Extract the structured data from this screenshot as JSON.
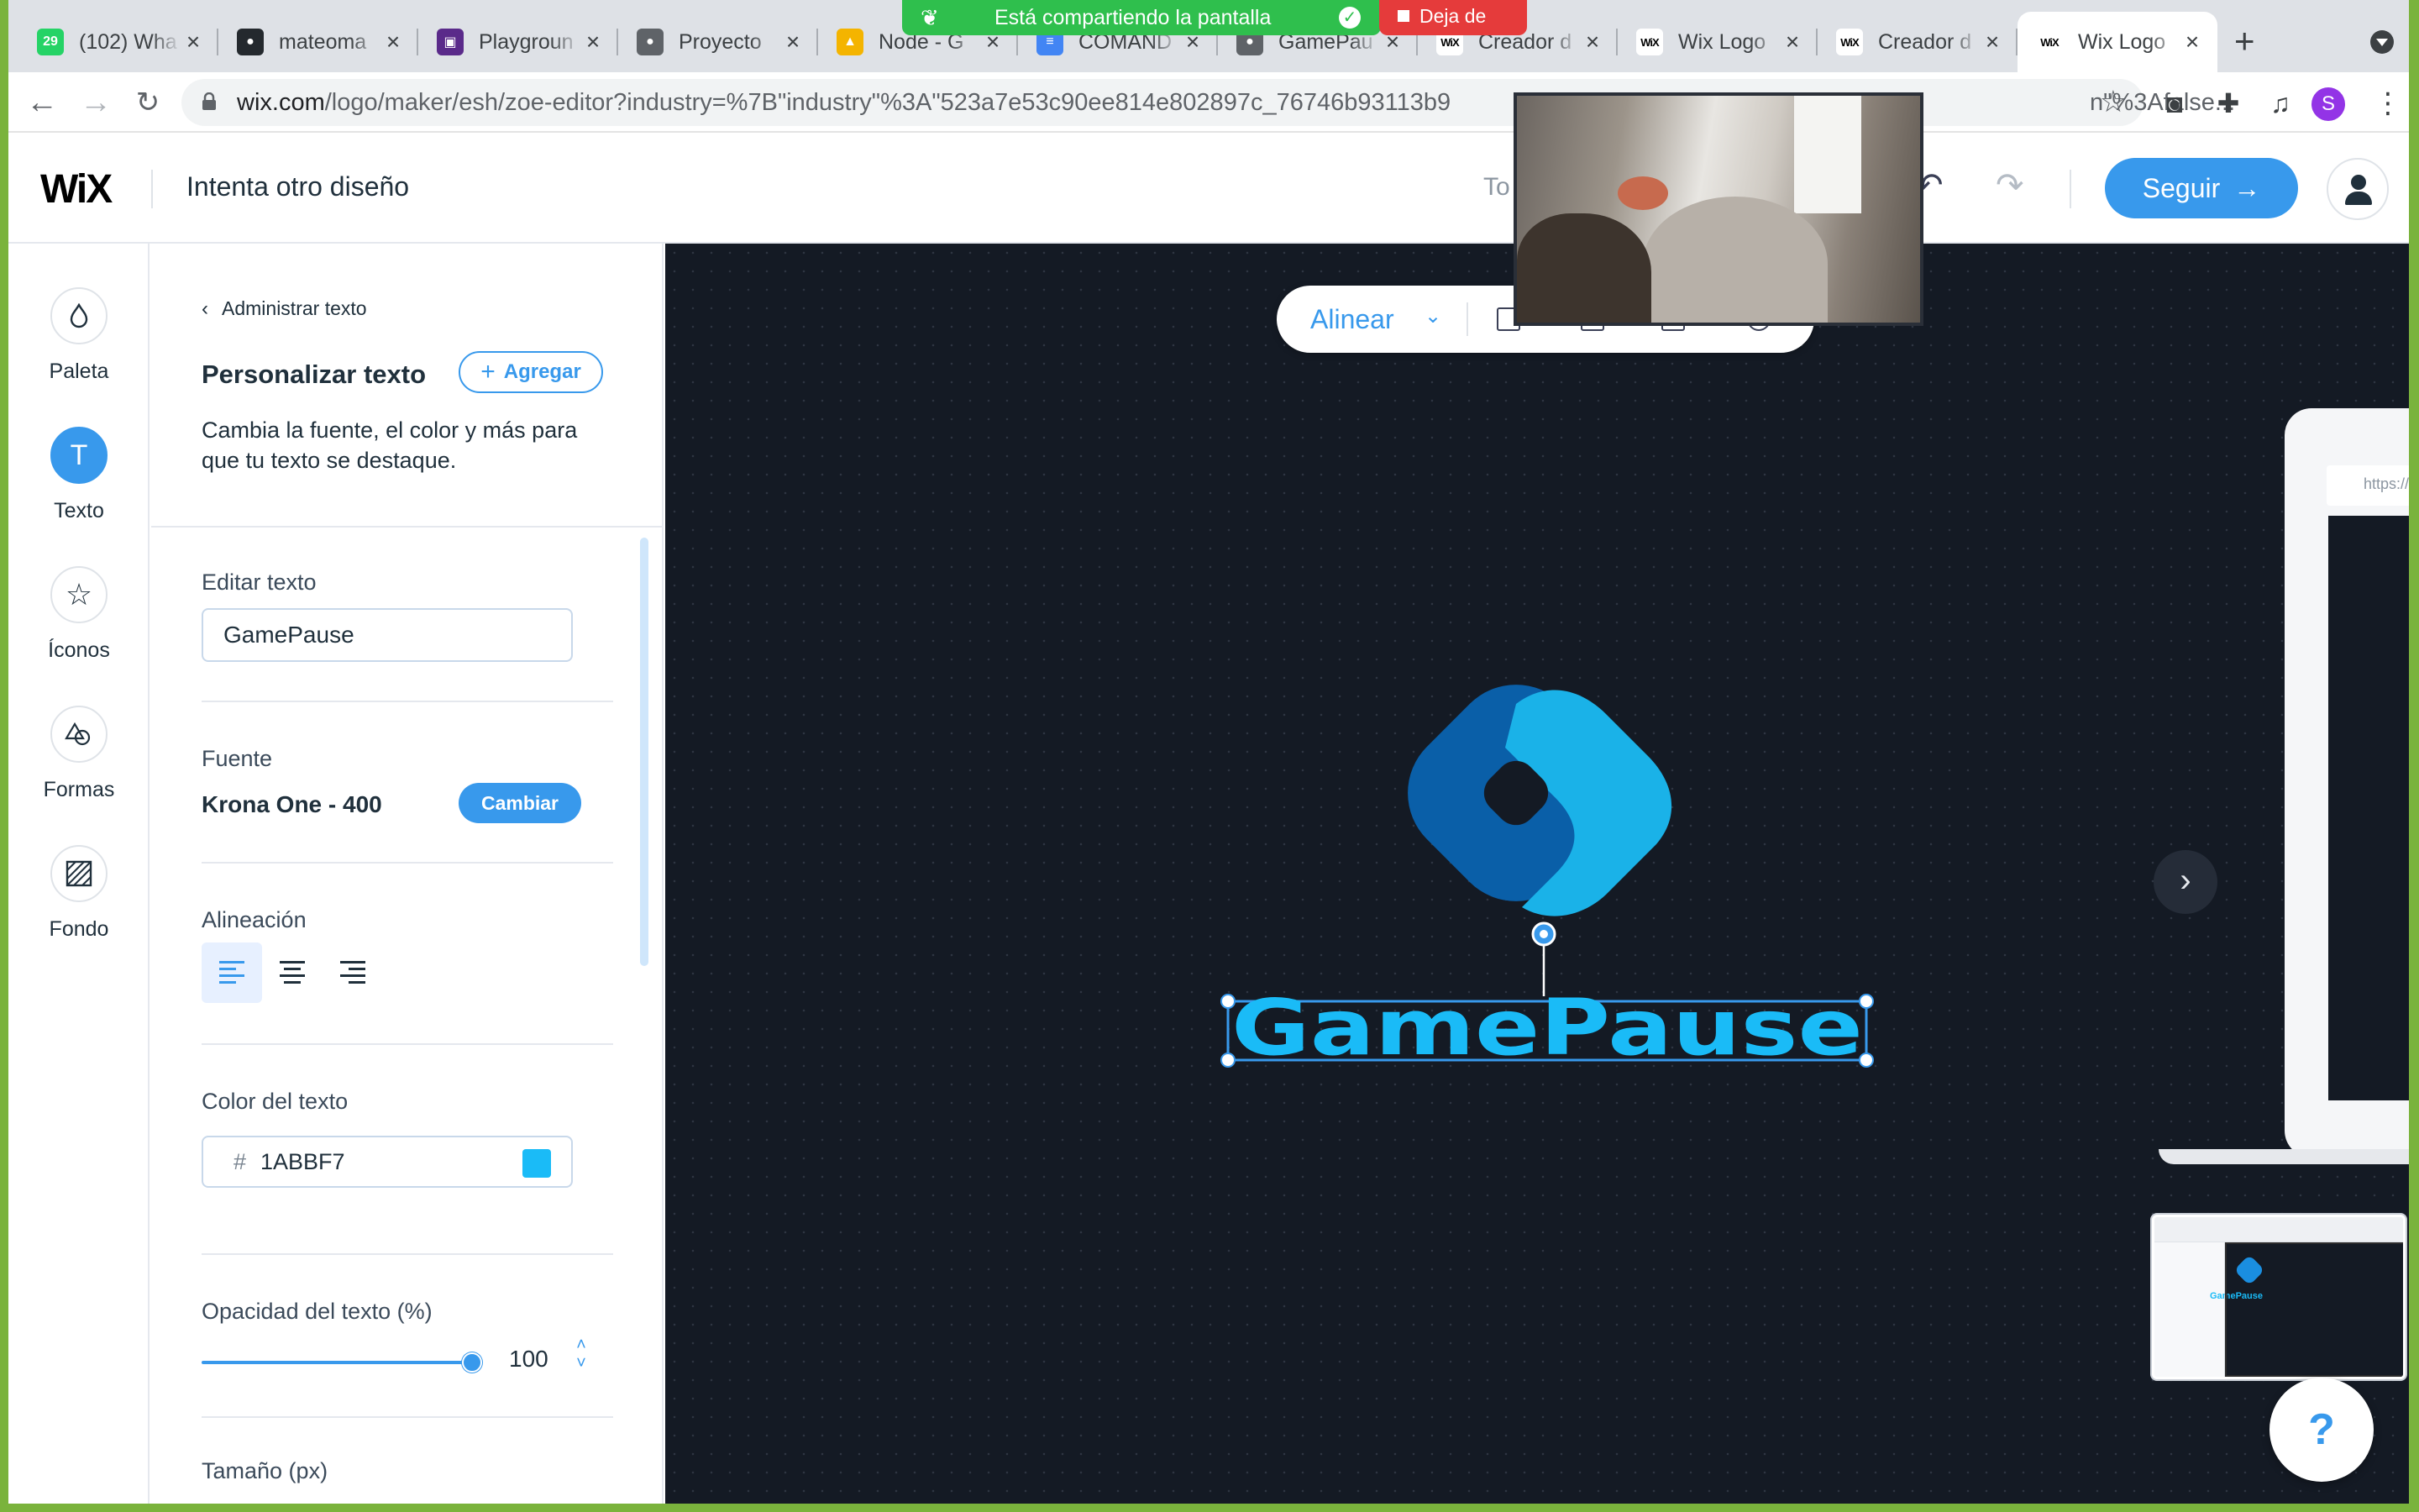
{
  "browser": {
    "tabs": [
      {
        "title": "(102) Wha",
        "favicon": "whatsapp-icon",
        "color": "#25d366",
        "glyph": "29"
      },
      {
        "title": "mateoma",
        "favicon": "github-icon",
        "color": "#24292e",
        "glyph": "●"
      },
      {
        "title": "Playgroun",
        "favicon": "playground-icon",
        "color": "#5a2a8a",
        "glyph": "▣"
      },
      {
        "title": "Proyecto",
        "favicon": "github-icon",
        "color": "#5f6368",
        "glyph": "●"
      },
      {
        "title": "Node - G",
        "favicon": "google-drive-icon",
        "color": "#f4b400",
        "glyph": "▲"
      },
      {
        "title": "COMAND",
        "favicon": "google-docs-icon",
        "color": "#4285f4",
        "glyph": "≡"
      },
      {
        "title": "GamePau",
        "favicon": "github-icon",
        "color": "#5f6368",
        "glyph": "●"
      },
      {
        "title": "Creador d",
        "favicon": "wix-icon",
        "color": "#ffffff",
        "glyph": "WiX"
      },
      {
        "title": "Wix Logo",
        "favicon": "wix-icon",
        "color": "#ffffff",
        "glyph": "WiX"
      },
      {
        "title": "Creador d",
        "favicon": "wix-icon",
        "color": "#ffffff",
        "glyph": "WiX"
      },
      {
        "title": "Wix Logo",
        "favicon": "wix-icon",
        "color": "#ffffff",
        "glyph": "WiX"
      }
    ],
    "active_tab_index": 10,
    "url_host": "wix.com",
    "url_path": "/logo/maker/esh/zoe-editor?industry=%7B\"industry\"%3A\"523a7e53c90ee814e802897c_76746b93113b9",
    "url_tail": "n\"%3Afalse...",
    "profile_initial": "S"
  },
  "share_banner": {
    "text": "Está compartiendo la pantalla",
    "stop_label": "Deja de"
  },
  "header": {
    "brand": "WiX",
    "title": "Intenta otro diseño",
    "partial_text": "To",
    "next_label": "Seguir"
  },
  "rail": {
    "items": [
      {
        "label": "Paleta",
        "icon": "palette-icon",
        "glyph": "◊"
      },
      {
        "label": "Texto",
        "icon": "text-icon",
        "glyph": "T"
      },
      {
        "label": "Íconos",
        "icon": "star-icon",
        "glyph": "☆"
      },
      {
        "label": "Formas",
        "icon": "shapes-icon",
        "glyph": "⬠"
      },
      {
        "label": "Fondo",
        "icon": "background-icon",
        "glyph": "▨"
      }
    ],
    "active_index": 1
  },
  "panel": {
    "back_label": "Administrar texto",
    "title": "Personalizar texto",
    "add_label": "Agregar",
    "description": "Cambia la fuente, el color y más para que tu texto se destaque.",
    "edit_text_label": "Editar texto",
    "edit_text_value": "GamePause",
    "font_label": "Fuente",
    "font_value": "Krona One - 400",
    "change_font_label": "Cambiar",
    "alignment_label": "Alineación",
    "alignment_selected": "left",
    "text_color_label": "Color del texto",
    "text_color_hex": "1ABBF7",
    "text_color": "#1abbf7",
    "opacity_label": "Opacidad del texto (%)",
    "opacity_value": "100",
    "size_label": "Tamaño (px)"
  },
  "canvas": {
    "align_label": "Alinear",
    "logo_text": "GamePause",
    "logo_colors": {
      "dark": "#0a5fa8",
      "mid": "#1a7ec8",
      "light": "#1ab2e8"
    }
  },
  "help": {
    "label": "?"
  }
}
